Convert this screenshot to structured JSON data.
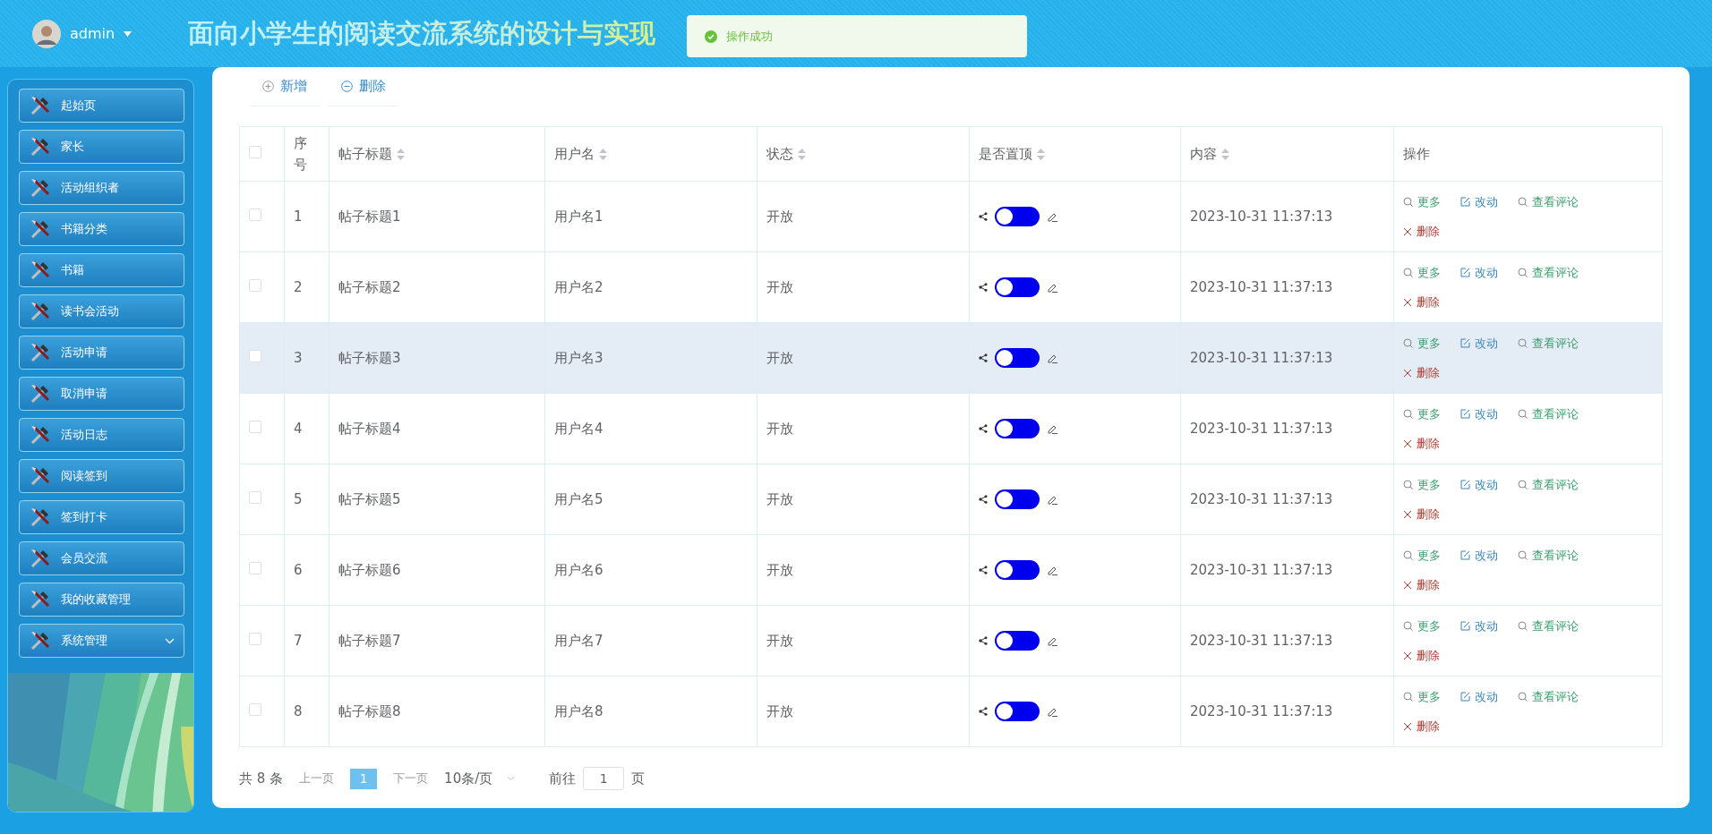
{
  "header": {
    "user": "admin",
    "title": "面向小学生的阅读交流系统的设计与实现"
  },
  "toast": {
    "message": "操作成功"
  },
  "sidebar": {
    "items": [
      {
        "label": "起始页",
        "expandable": false
      },
      {
        "label": "家长",
        "expandable": false
      },
      {
        "label": "活动组织者",
        "expandable": false
      },
      {
        "label": "书籍分类",
        "expandable": false
      },
      {
        "label": "书籍",
        "expandable": false
      },
      {
        "label": "读书会活动",
        "expandable": false
      },
      {
        "label": "活动申请",
        "expandable": false
      },
      {
        "label": "取消申请",
        "expandable": false
      },
      {
        "label": "活动日志",
        "expandable": false
      },
      {
        "label": "阅读签到",
        "expandable": false
      },
      {
        "label": "签到打卡",
        "expandable": false
      },
      {
        "label": "会员交流",
        "expandable": false
      },
      {
        "label": "我的收藏管理",
        "expandable": false
      },
      {
        "label": "系统管理",
        "expandable": true
      }
    ]
  },
  "toolbar": [
    {
      "label": "新增",
      "kind": "add"
    },
    {
      "label": "删除",
      "kind": "remove"
    }
  ],
  "table": {
    "select_all_checked": false,
    "columns": [
      {
        "label": "序号",
        "sortable": false
      },
      {
        "label": "帖子标题",
        "sortable": true
      },
      {
        "label": "用户名",
        "sortable": true
      },
      {
        "label": "状态",
        "sortable": true
      },
      {
        "label": "是否置顶",
        "sortable": true
      },
      {
        "label": "内容",
        "sortable": true
      },
      {
        "label": "操作",
        "sortable": false
      }
    ],
    "rows": [
      {
        "index": "1",
        "title": "帖子标题1",
        "user": "用户名1",
        "status": "开放",
        "pinned": false,
        "content": "2023-10-31 11:37:13",
        "checked": false,
        "highlighted": false,
        "actions": [
          {
            "label": "更多",
            "kind": "more"
          },
          {
            "label": "改动",
            "kind": "edit"
          },
          {
            "label": "查看评论",
            "kind": "comments"
          },
          {
            "label": "删除",
            "kind": "delete"
          }
        ]
      },
      {
        "index": "2",
        "title": "帖子标题2",
        "user": "用户名2",
        "status": "开放",
        "pinned": false,
        "content": "2023-10-31 11:37:13",
        "checked": false,
        "highlighted": false,
        "actions": [
          {
            "label": "更多",
            "kind": "more"
          },
          {
            "label": "改动",
            "kind": "edit"
          },
          {
            "label": "查看评论",
            "kind": "comments"
          },
          {
            "label": "删除",
            "kind": "delete"
          }
        ]
      },
      {
        "index": "3",
        "title": "帖子标题3",
        "user": "用户名3",
        "status": "开放",
        "pinned": false,
        "content": "2023-10-31 11:37:13",
        "checked": false,
        "highlighted": true,
        "actions": [
          {
            "label": "更多",
            "kind": "more"
          },
          {
            "label": "改动",
            "kind": "edit"
          },
          {
            "label": "查看评论",
            "kind": "comments"
          },
          {
            "label": "删除",
            "kind": "delete"
          }
        ]
      },
      {
        "index": "4",
        "title": "帖子标题4",
        "user": "用户名4",
        "status": "开放",
        "pinned": false,
        "content": "2023-10-31 11:37:13",
        "checked": false,
        "highlighted": false,
        "actions": [
          {
            "label": "更多",
            "kind": "more"
          },
          {
            "label": "改动",
            "kind": "edit"
          },
          {
            "label": "查看评论",
            "kind": "comments"
          },
          {
            "label": "删除",
            "kind": "delete"
          }
        ]
      },
      {
        "index": "5",
        "title": "帖子标题5",
        "user": "用户名5",
        "status": "开放",
        "pinned": false,
        "content": "2023-10-31 11:37:13",
        "checked": false,
        "highlighted": false,
        "actions": [
          {
            "label": "更多",
            "kind": "more"
          },
          {
            "label": "改动",
            "kind": "edit"
          },
          {
            "label": "查看评论",
            "kind": "comments"
          },
          {
            "label": "删除",
            "kind": "delete"
          }
        ]
      },
      {
        "index": "6",
        "title": "帖子标题6",
        "user": "用户名6",
        "status": "开放",
        "pinned": false,
        "content": "2023-10-31 11:37:13",
        "checked": false,
        "highlighted": false,
        "actions": [
          {
            "label": "更多",
            "kind": "more"
          },
          {
            "label": "改动",
            "kind": "edit"
          },
          {
            "label": "查看评论",
            "kind": "comments"
          },
          {
            "label": "删除",
            "kind": "delete"
          }
        ]
      },
      {
        "index": "7",
        "title": "帖子标题7",
        "user": "用户名7",
        "status": "开放",
        "pinned": false,
        "content": "2023-10-31 11:37:13",
        "checked": false,
        "highlighted": false,
        "actions": [
          {
            "label": "更多",
            "kind": "more"
          },
          {
            "label": "改动",
            "kind": "edit"
          },
          {
            "label": "查看评论",
            "kind": "comments"
          },
          {
            "label": "删除",
            "kind": "delete"
          }
        ]
      },
      {
        "index": "8",
        "title": "帖子标题8",
        "user": "用户名8",
        "status": "开放",
        "pinned": false,
        "content": "2023-10-31 11:37:13",
        "checked": false,
        "highlighted": false,
        "actions": [
          {
            "label": "更多",
            "kind": "more"
          },
          {
            "label": "改动",
            "kind": "edit"
          },
          {
            "label": "查看评论",
            "kind": "comments"
          },
          {
            "label": "删除",
            "kind": "delete"
          }
        ]
      }
    ]
  },
  "pagination": {
    "total": "共 8 条",
    "prev": "上一页",
    "pages": [
      {
        "label": "1",
        "selected": true
      }
    ],
    "next": "下一页",
    "page_size": "10条/页",
    "goto_label": "前往",
    "goto_value": "1",
    "goto_suffix": "页"
  }
}
